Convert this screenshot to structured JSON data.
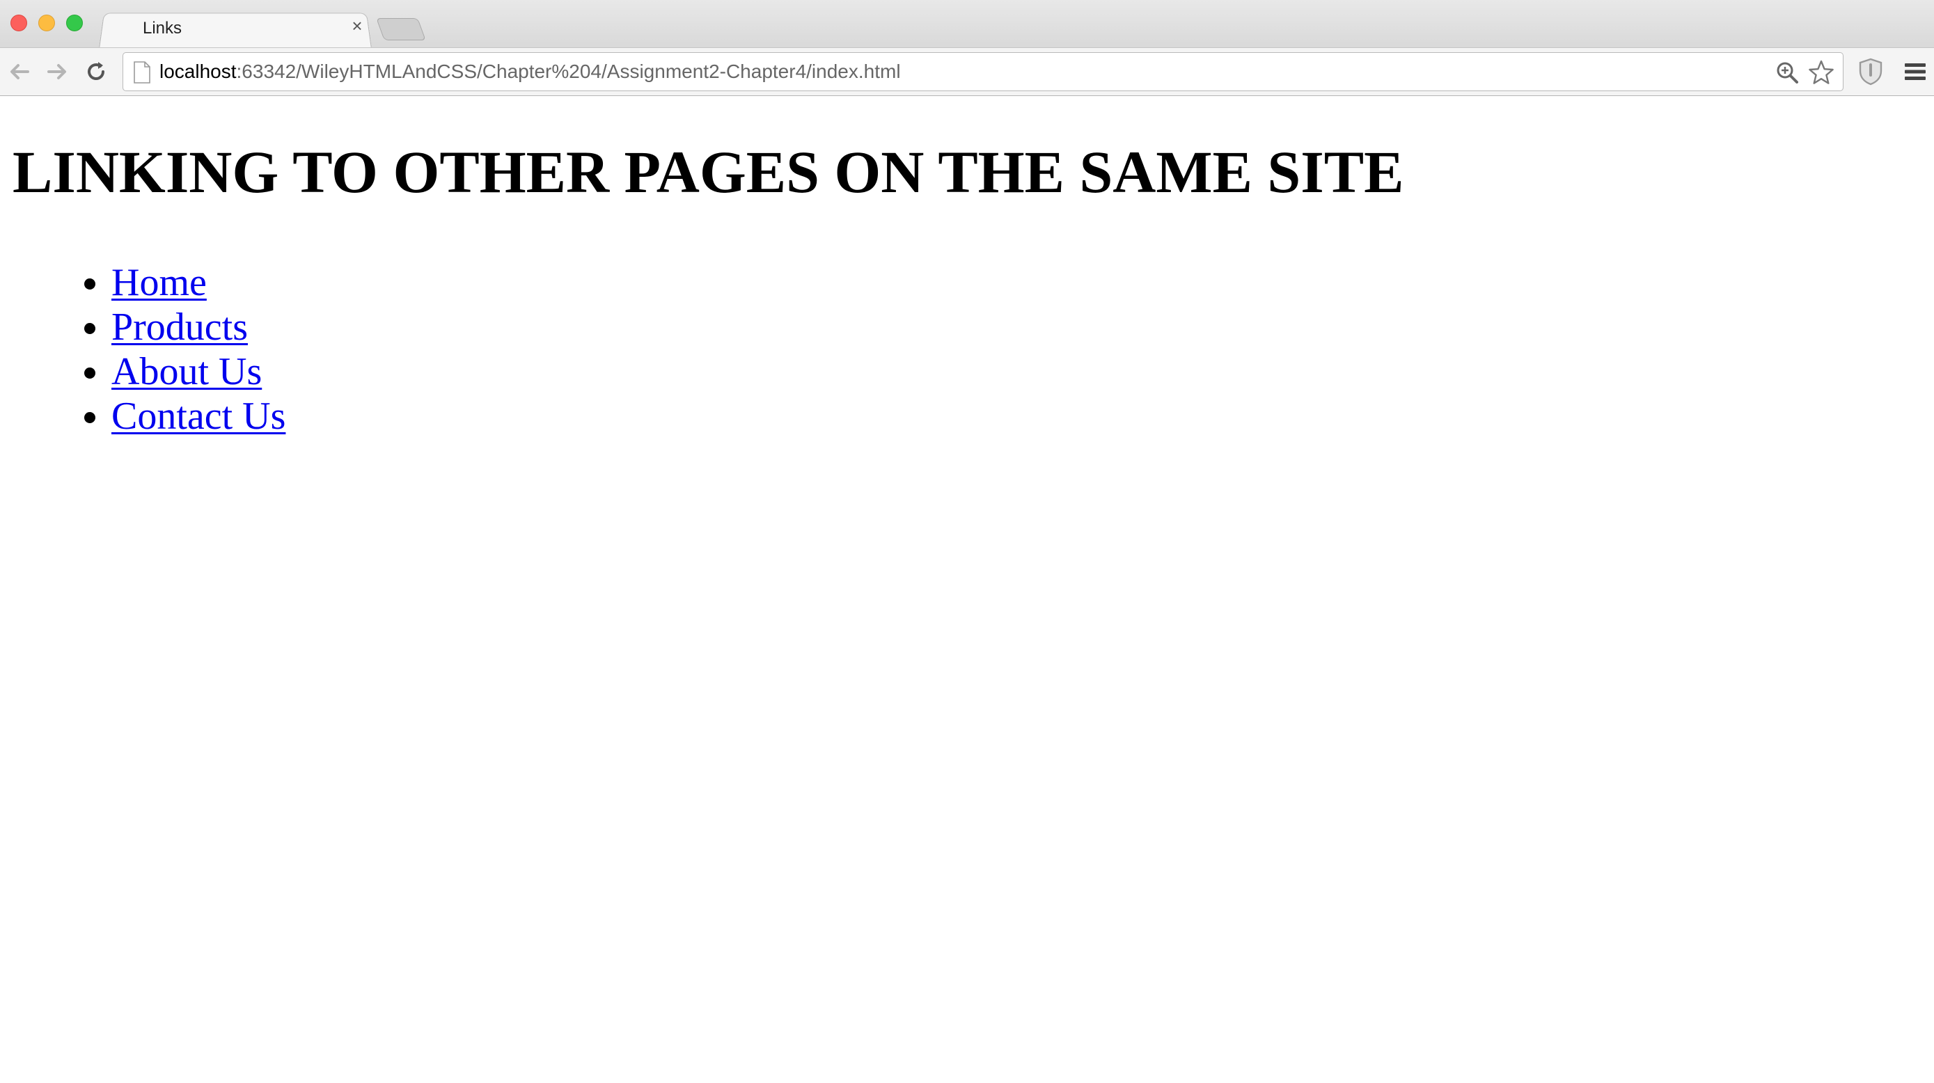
{
  "browser": {
    "tab": {
      "title": "Links",
      "close_glyph": "×"
    },
    "address_bar": {
      "host": "localhost",
      "path": ":63342/WileyHTMLAndCSS/Chapter%204/Assignment2-Chapter4/index.html"
    },
    "icons": {
      "back": "back-arrow-icon",
      "forward": "forward-arrow-icon",
      "reload": "reload-icon",
      "page": "page-icon",
      "zoom": "zoom-icon",
      "bookmark": "star-icon",
      "extension": "shield-icon",
      "menu": "hamburger-menu-icon"
    },
    "colors": {
      "traffic_close": "#fc605c",
      "traffic_minimize": "#fdbc40",
      "traffic_maximize": "#34c84a"
    }
  },
  "page": {
    "heading": "LINKING TO OTHER PAGES ON THE SAME SITE",
    "links": [
      {
        "label": "Home"
      },
      {
        "label": "Products"
      },
      {
        "label": "About Us"
      },
      {
        "label": "Contact Us"
      }
    ],
    "link_color": "#0000ee"
  }
}
